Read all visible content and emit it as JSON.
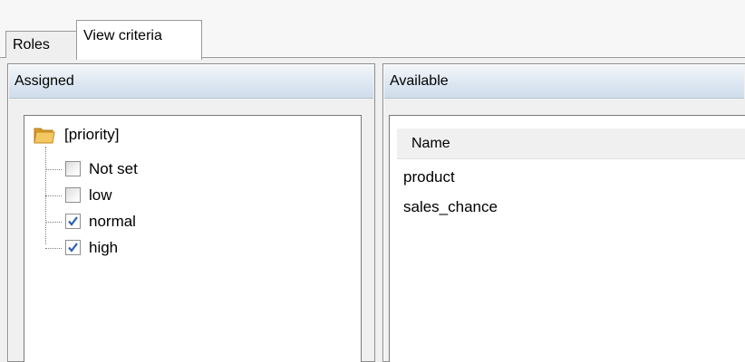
{
  "tabs": [
    {
      "label": "Roles",
      "active": false
    },
    {
      "label": "View criteria",
      "active": true
    }
  ],
  "assigned": {
    "header": "Assigned",
    "tree": {
      "root_label": "[priority]",
      "root_icon": "folder-icon",
      "items": [
        {
          "label": "Not set",
          "checked": false
        },
        {
          "label": "low",
          "checked": false
        },
        {
          "label": "normal",
          "checked": true
        },
        {
          "label": "high",
          "checked": true
        }
      ]
    }
  },
  "available": {
    "header": "Available",
    "column": "Name",
    "rows": [
      "product",
      "sales_chance"
    ]
  },
  "colors": {
    "header_gradient_top": "#f3f6fa",
    "header_gradient_bottom": "#cfdcea",
    "checkmark": "#2c5fb0",
    "folder": "#e8b64c"
  }
}
